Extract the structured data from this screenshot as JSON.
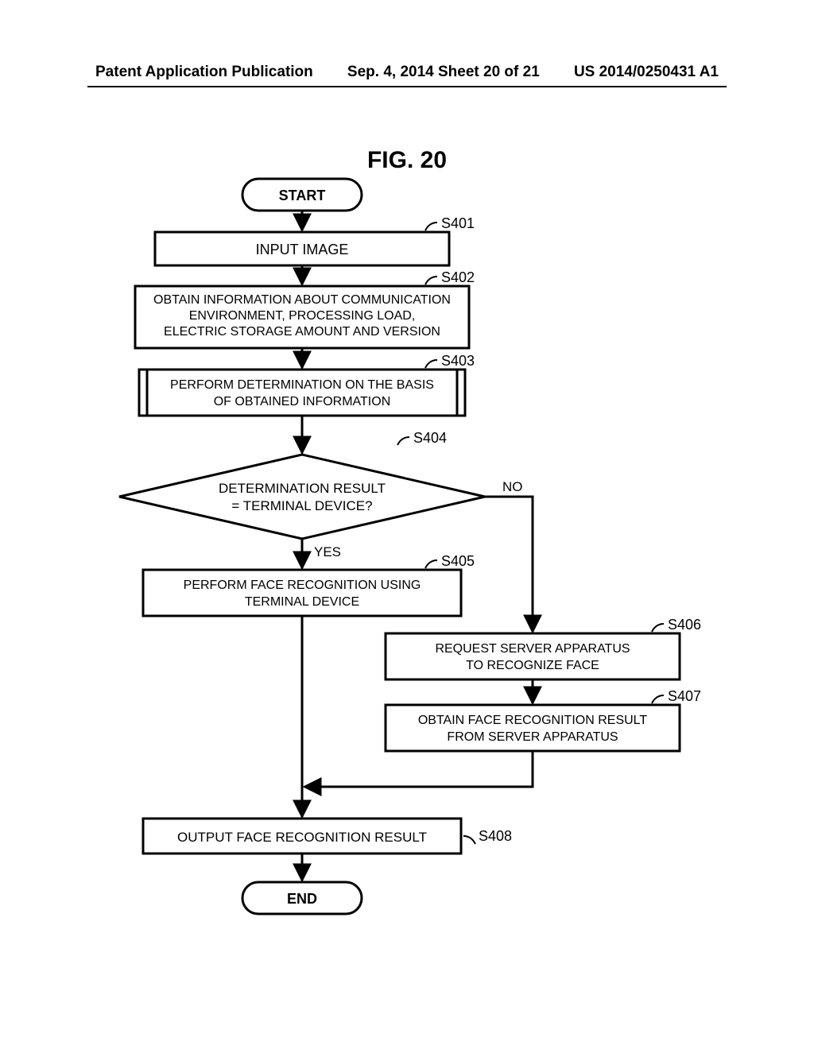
{
  "header": {
    "left": "Patent Application Publication",
    "center": "Sep. 4, 2014   Sheet 20 of 21",
    "right": "US 2014/0250431 A1"
  },
  "figure_title": "FIG. 20",
  "steps": {
    "start": "START",
    "s401": {
      "ref": "S401",
      "text": "INPUT IMAGE"
    },
    "s402": {
      "ref": "S402",
      "text1": "OBTAIN INFORMATION ABOUT COMMUNICATION",
      "text2": "ENVIRONMENT, PROCESSING LOAD,",
      "text3": "ELECTRIC STORAGE AMOUNT AND VERSION"
    },
    "s403": {
      "ref": "S403",
      "text1": "PERFORM DETERMINATION ON THE BASIS",
      "text2": "OF OBTAINED INFORMATION"
    },
    "s404": {
      "ref": "S404",
      "text1": "DETERMINATION RESULT",
      "text2": "= TERMINAL DEVICE?",
      "yes": "YES",
      "no": "NO"
    },
    "s405": {
      "ref": "S405",
      "text1": "PERFORM FACE RECOGNITION USING",
      "text2": "TERMINAL DEVICE"
    },
    "s406": {
      "ref": "S406",
      "text1": "REQUEST SERVER APPARATUS",
      "text2": "TO RECOGNIZE FACE"
    },
    "s407": {
      "ref": "S407",
      "text1": "OBTAIN FACE RECOGNITION RESULT",
      "text2": "FROM SERVER APPARATUS"
    },
    "s408": {
      "ref": "S408",
      "text": "OUTPUT FACE RECOGNITION RESULT"
    },
    "end": "END"
  }
}
